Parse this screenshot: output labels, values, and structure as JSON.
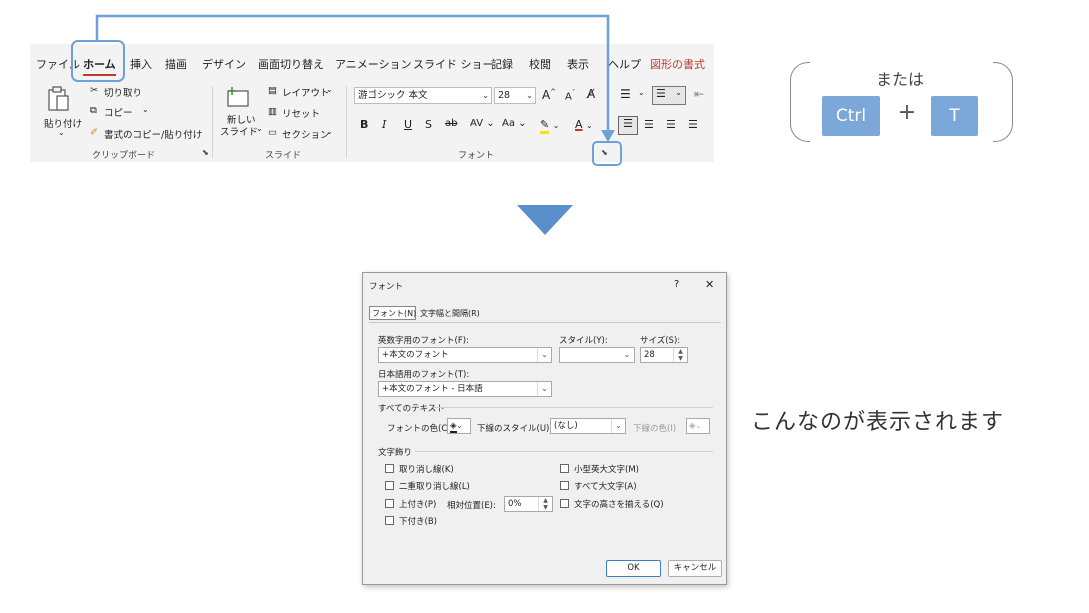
{
  "ribbon": {
    "tabs": [
      "ファイル",
      "ホーム",
      "挿入",
      "描画",
      "デザイン",
      "画面切り替え",
      "アニメーション",
      "スライド ショー",
      "記録",
      "校閲",
      "表示",
      "ヘルプ",
      "図形の書式"
    ],
    "clipboard": {
      "paste": "貼り付け",
      "cut": "切り取り",
      "copy": "コピー",
      "format_painter": "書式のコピー/貼り付け",
      "label": "クリップボード"
    },
    "slides": {
      "new_slide_line1": "新しい",
      "new_slide_line2": "スライド",
      "layout": "レイアウト",
      "reset": "リセット",
      "section": "セクション",
      "label": "スライド"
    },
    "font": {
      "font_name": "游ゴシック 本文",
      "font_size": "28",
      "label": "フォント",
      "bold": "B",
      "italic": "I",
      "underline": "U",
      "shadow": "S",
      "strike": "ab",
      "spacing": "AV",
      "case": "Aa",
      "grow": "A",
      "shrink": "A",
      "color": "A"
    }
  },
  "shortcut": {
    "or_text": "または",
    "key1": "Ctrl",
    "plus": "+",
    "key2": "T"
  },
  "caption": "こんなのが表示されます",
  "dialog": {
    "title": "フォント",
    "help": "?",
    "close": "✕",
    "tab_font": "フォント(N)",
    "tab_spacing": "文字幅と間隔(R)",
    "latin_label": "英数字用のフォント(F):",
    "latin_value": "+本文のフォント",
    "style_label": "スタイル(Y):",
    "style_value": "",
    "size_label": "サイズ(S):",
    "size_value": "28",
    "asian_label": "日本語用のフォント(T):",
    "asian_value": "+本文のフォント - 日本語",
    "all_text_header": "すべてのテキスト",
    "font_color_label": "フォントの色(C)",
    "underline_style_label": "下線のスタイル(U)",
    "underline_style_value": "(なし)",
    "underline_color_label": "下線の色(I)",
    "effects_header": "文字飾り",
    "effects_left": [
      "取り消し線(K)",
      "二重取り消し線(L)",
      "上付き(P)",
      "下付き(B)"
    ],
    "offset_label": "相対位置(E):",
    "offset_value": "0%",
    "effects_right": [
      "小型英大文字(M)",
      "すべて大文字(A)",
      "文字の高さを揃える(Q)"
    ],
    "ok": "OK",
    "cancel": "キャンセル"
  }
}
